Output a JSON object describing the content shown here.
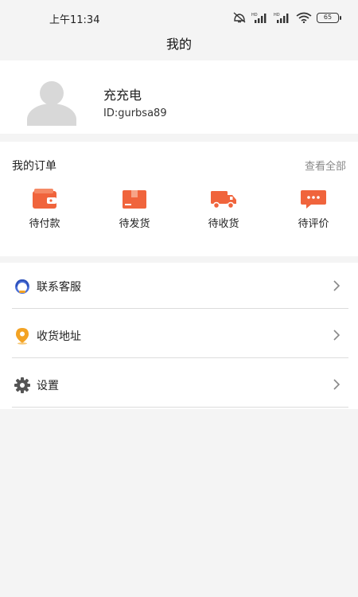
{
  "status_bar": {
    "time": "上午11:34",
    "battery": "65"
  },
  "header": {
    "title": "我的"
  },
  "profile": {
    "name": "充充电",
    "id": "ID:gurbsa89"
  },
  "orders": {
    "title": "我的订单",
    "view_all": "查看全部",
    "items": [
      {
        "label": "待付款",
        "icon": "wallet-icon"
      },
      {
        "label": "待发货",
        "icon": "package-icon"
      },
      {
        "label": "待收货",
        "icon": "truck-icon"
      },
      {
        "label": "待评价",
        "icon": "comment-icon"
      }
    ]
  },
  "menu": {
    "items": [
      {
        "label": "联系客服",
        "icon": "customer-service-icon"
      },
      {
        "label": "收货地址",
        "icon": "location-icon"
      },
      {
        "label": "设置",
        "icon": "gear-icon"
      }
    ]
  },
  "colors": {
    "accent": "#f0643c",
    "service_blue": "#4a6fd8",
    "location_orange": "#f3a324",
    "gear_gray": "#555555"
  }
}
